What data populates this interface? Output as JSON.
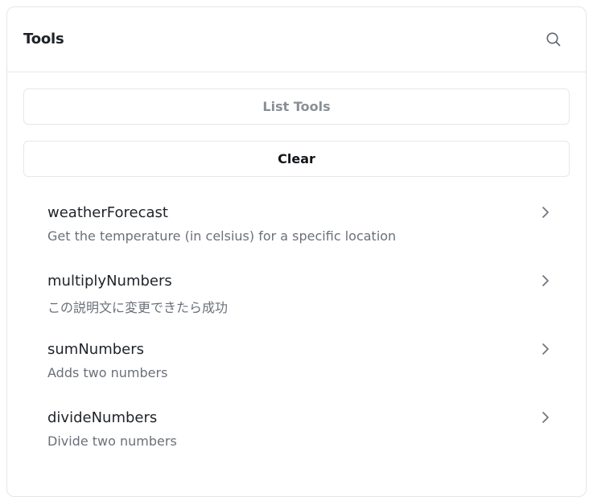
{
  "panel": {
    "title": "Tools",
    "search_icon": "search-icon"
  },
  "buttons": {
    "list_tools_label": "List Tools",
    "clear_label": "Clear"
  },
  "tools": [
    {
      "name": "weatherForecast",
      "description": "Get the temperature (in celsius) for a specific location"
    },
    {
      "name": "multiplyNumbers",
      "description": "この説明文に変更できたら成功"
    },
    {
      "name": "sumNumbers",
      "description": "Adds two numbers"
    },
    {
      "name": "divideNumbers",
      "description": "Divide two numbers"
    }
  ],
  "colors": {
    "title": "#1f2328",
    "description": "#6b7078",
    "muted_button_text": "#8a8f96",
    "border": "#e5e7eb"
  }
}
